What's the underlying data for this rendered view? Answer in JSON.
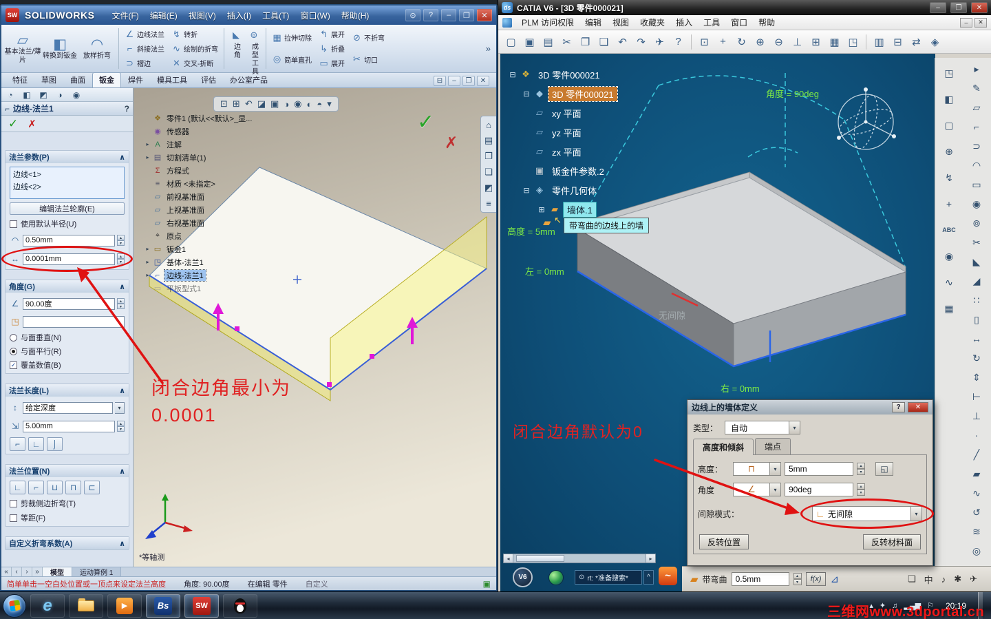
{
  "ui": {
    "chevron_up": "∧",
    "dropdown_arrow": "▾",
    "spin_up": "▴",
    "spin_down": "▾",
    "check": "✓",
    "cross": "✗",
    "help": "?",
    "minimize": "–",
    "restore": "❐",
    "close": "✕",
    "overflow": "»",
    "search": "⊙",
    "caret_up": "^"
  },
  "watermark": "三维网www.3dportal.cn",
  "solidworks": {
    "logo_badge": "SW",
    "logo_text": "SOLIDWORKS",
    "menus": [
      "文件(F)",
      "编辑(E)",
      "视图(V)",
      "插入(I)",
      "工具(T)",
      "窗口(W)",
      "帮助(H)"
    ],
    "tabs": [
      {
        "label": "特征",
        "active": "false"
      },
      {
        "label": "草图",
        "active": "false"
      },
      {
        "label": "曲面",
        "active": "false"
      },
      {
        "label": "钣金",
        "active": "true"
      },
      {
        "label": "焊件",
        "active": "false"
      },
      {
        "label": "模具工具",
        "active": "false"
      },
      {
        "label": "评估",
        "active": "false"
      },
      {
        "label": "办公室产品",
        "active": "false"
      }
    ],
    "doc_controls": [
      {
        "name": "cascade-icon",
        "glyph": "⊟"
      },
      {
        "name": "doc-minimize-icon",
        "glyph": "–"
      },
      {
        "name": "doc-restore-icon",
        "glyph": "❐"
      },
      {
        "name": "doc-close-icon",
        "glyph": "✕"
      }
    ],
    "ribbon": {
      "big": [
        {
          "name": "base-flange-button",
          "glyph": "▱",
          "label": "基本法兰/薄片"
        },
        {
          "name": "convert-to-sheetmetal-button",
          "glyph": "◧",
          "label": "转换到钣金"
        },
        {
          "name": "lofted-bend-button",
          "glyph": "◠",
          "label": "放样折弯"
        }
      ],
      "stack1": [
        {
          "name": "edge-flange-button",
          "glyph": "∠",
          "label": "边线法兰"
        },
        {
          "name": "miter-flange-button",
          "glyph": "⌐",
          "label": "斜接法兰"
        },
        {
          "name": "hem-button",
          "glyph": "⊃",
          "label": "褶边"
        }
      ],
      "stack2": [
        {
          "name": "jog-button",
          "glyph": "↯",
          "label": "转折"
        },
        {
          "name": "sketched-bend-button",
          "glyph": "∿",
          "label": "绘制的折弯"
        },
        {
          "name": "cross-break-button",
          "glyph": "✕",
          "label": "交叉-折断"
        }
      ],
      "vertical": [
        {
          "name": "corners-button",
          "glyph": "◣",
          "label": "边角"
        },
        {
          "name": "forming-tool-button",
          "glyph": "⊚",
          "label": "成型工具"
        }
      ],
      "stack3": [
        {
          "name": "extruded-cut-button",
          "glyph": "▦",
          "label": "拉伸切除"
        },
        {
          "name": "simple-hole-button",
          "glyph": "◎",
          "label": "简单直孔"
        }
      ],
      "stack4": [
        {
          "name": "unfold-button",
          "glyph": "↰",
          "label": "展开"
        },
        {
          "name": "fold-button",
          "glyph": "↳",
          "label": "折叠"
        },
        {
          "name": "flatten-button",
          "glyph": "▭",
          "label": "展开"
        }
      ],
      "stack5": [
        {
          "name": "no-bends-button",
          "glyph": "⊘",
          "label": "不折弯"
        },
        {
          "name": "rip-button",
          "glyph": "✂",
          "label": "切口"
        }
      ]
    },
    "pm_tabs": [
      {
        "name": "featuremanager-tab-icon",
        "glyph": "◔"
      },
      {
        "name": "propertymanager-tab-icon",
        "glyph": "◧"
      },
      {
        "name": "configuration-tab-icon",
        "glyph": "◩"
      },
      {
        "name": "dimxpert-tab-icon",
        "glyph": "◑"
      },
      {
        "name": "appearance-tab-icon",
        "glyph": "◉"
      }
    ],
    "panel": {
      "title": "边线-法兰1",
      "title_icon": "⌐",
      "sections": {
        "params_title": "法兰参数(P)",
        "edges": [
          "边线<1>",
          "边线<2>"
        ],
        "edit_profile": "编辑法兰轮廓(E)",
        "use_default_radius": "使用默认半径(U)",
        "radius": "0.50mm",
        "gap": "0.0001mm",
        "angle_title": "角度(G)",
        "angle": "90.00度",
        "face": "",
        "normal_to_face": "与面垂直(N)",
        "parallel_to_face": "与面平行(R)",
        "override_value": "覆盖数值(B)",
        "length_title": "法兰长度(L)",
        "end_condition": "给定深度",
        "depth": "5.00mm",
        "position_title": "法兰位置(N)",
        "trim_side_bends": "剪裁侧边折弯(T)",
        "offset": "等距(F)",
        "custom_title": "自定义折弯系数(A)"
      },
      "length_buttons": [
        {
          "name": "outer-virtual-sharp-button",
          "glyph": "⌐"
        },
        {
          "name": "inner-virtual-sharp-button",
          "glyph": "∟"
        },
        {
          "name": "tangent-bend-button",
          "glyph": "⌡"
        }
      ],
      "position_buttons": [
        {
          "name": "material-inside-button",
          "glyph": "∟"
        },
        {
          "name": "material-outside-button",
          "glyph": "⌐"
        },
        {
          "name": "bend-outside-button",
          "glyph": "⊔"
        },
        {
          "name": "bend-from-virtual-sharp-button",
          "glyph": "⊓"
        },
        {
          "name": "tangent-to-bend-button",
          "glyph": "⊏"
        }
      ]
    },
    "tree": [
      {
        "glyph": "❖",
        "color": "#8a6d1e",
        "label": "零件1 (默认<<默认>_显...",
        "exp": "",
        "state": ""
      },
      {
        "glyph": "◉",
        "color": "#7a4fa0",
        "label": "传感器",
        "exp": "",
        "state": ""
      },
      {
        "glyph": "A",
        "color": "#2e7d4f",
        "label": "注解",
        "exp": "▸",
        "state": ""
      },
      {
        "glyph": "▤",
        "color": "#555577",
        "label": "切割清单(1)",
        "exp": "▸",
        "state": ""
      },
      {
        "glyph": "Σ",
        "color": "#a03030",
        "label": "方程式",
        "exp": "",
        "state": ""
      },
      {
        "glyph": "≡",
        "color": "#556",
        "label": "材质 <未指定>",
        "exp": "",
        "state": ""
      },
      {
        "glyph": "▱",
        "color": "#3a6a9a",
        "label": "前视基准面",
        "exp": "",
        "state": ""
      },
      {
        "glyph": "▱",
        "color": "#3a6a9a",
        "label": "上视基准面",
        "exp": "",
        "state": ""
      },
      {
        "glyph": "▱",
        "color": "#3a6a9a",
        "label": "右视基准面",
        "exp": "",
        "state": ""
      },
      {
        "glyph": "⌖",
        "color": "#333333",
        "label": "原点",
        "exp": "",
        "state": ""
      },
      {
        "glyph": "▭",
        "color": "#8a6d1e",
        "label": "钣金1",
        "exp": "▸",
        "state": ""
      },
      {
        "glyph": "◳",
        "color": "#33539e",
        "label": "基体-法兰1",
        "exp": "▸",
        "state": ""
      },
      {
        "glyph": "⌐",
        "color": "#33539e",
        "label": "边线-法兰1",
        "exp": "▸",
        "state": "sel"
      },
      {
        "glyph": "▭",
        "color": "#888899",
        "label": "平板型式1",
        "exp": "",
        "state": "dim"
      }
    ],
    "headsup": [
      {
        "name": "zoom-fit-icon",
        "glyph": "⊡"
      },
      {
        "name": "zoom-area-icon",
        "glyph": "⊞"
      },
      {
        "name": "previous-view-icon",
        "glyph": "↶"
      },
      {
        "name": "section-view-icon",
        "glyph": "◪"
      },
      {
        "name": "view-orientation-icon",
        "glyph": "▣"
      },
      {
        "name": "display-style-icon",
        "glyph": "◑"
      },
      {
        "name": "hide-show-icon",
        "glyph": "◉"
      },
      {
        "name": "edit-appearance-icon",
        "glyph": "◐"
      },
      {
        "name": "apply-scene-icon",
        "glyph": "◓"
      },
      {
        "name": "view-settings-icon",
        "glyph": "▾"
      }
    ],
    "taskpane": [
      {
        "name": "home-icon",
        "glyph": "⌂"
      },
      {
        "name": "design-library-icon",
        "glyph": "▤"
      },
      {
        "name": "file-explorer-icon",
        "glyph": "❐"
      },
      {
        "name": "view-palette-icon",
        "glyph": "❏"
      },
      {
        "name": "appearances-icon",
        "glyph": "◩"
      },
      {
        "name": "custom-properties-icon",
        "glyph": "≡"
      }
    ],
    "viewport": {
      "annotation_line1": "闭合边角最小为",
      "annotation_line2": "0.0001",
      "view_label": "*等轴测"
    },
    "doc_tabs_nav": [
      {
        "name": "first-tab-icon",
        "glyph": "«"
      },
      {
        "name": "prev-tab-icon",
        "glyph": "‹"
      },
      {
        "name": "next-tab-icon",
        "glyph": "›"
      },
      {
        "name": "last-tab-icon",
        "glyph": "»"
      }
    ],
    "doc_tabs": [
      {
        "label": "模型",
        "active": "true"
      },
      {
        "label": "运动算例 1",
        "active": "false"
      }
    ],
    "status": {
      "prompt": "简单单击一空白处位置或一顶点来设定法兰高度",
      "angle": "角度: 90.00度",
      "editing": "在编辑 零件",
      "custom": "自定义"
    }
  },
  "catia": {
    "title": "CATIA V6 - [3D 零件000021]",
    "app_icon": "ds",
    "menus": [
      "PLM 访问权限",
      "编辑",
      "视图",
      "收藏夹",
      "插入",
      "工具",
      "窗口",
      "帮助"
    ],
    "toolbar": [
      {
        "name": "new-file-icon",
        "glyph": "▢"
      },
      {
        "name": "open-file-icon",
        "glyph": "▣"
      },
      {
        "name": "print-icon",
        "glyph": "▤"
      },
      {
        "name": "cut-icon",
        "glyph": "✂"
      },
      {
        "name": "copy-icon",
        "glyph": "❐"
      },
      {
        "name": "paste-icon",
        "glyph": "❏"
      },
      {
        "name": "undo-icon",
        "glyph": "↶"
      },
      {
        "name": "redo-icon",
        "glyph": "↷"
      },
      {
        "name": "fly-mode-icon",
        "glyph": "✈"
      },
      {
        "name": "whats-this-icon",
        "glyph": "?"
      },
      {
        "name": "separator",
        "glyph": ""
      },
      {
        "name": "fit-all-icon",
        "glyph": "⊡"
      },
      {
        "name": "pan-icon",
        "glyph": "+"
      },
      {
        "name": "rotate-view-icon",
        "glyph": "↻"
      },
      {
        "name": "zoom-in-icon",
        "glyph": "⊕"
      },
      {
        "name": "zoom-out-icon",
        "glyph": "⊖"
      },
      {
        "name": "normal-view-icon",
        "glyph": "⊥"
      },
      {
        "name": "multi-view-icon",
        "glyph": "⊞"
      },
      {
        "name": "grid-icon",
        "glyph": "▦"
      },
      {
        "name": "isometric-icon",
        "glyph": "◳"
      },
      {
        "name": "separator",
        "glyph": ""
      },
      {
        "name": "catalog-icon",
        "glyph": "▥"
      },
      {
        "name": "sheet-icon",
        "glyph": "⊟"
      },
      {
        "name": "transfer-icon",
        "glyph": "⇄"
      },
      {
        "name": "assistant-icon",
        "glyph": "◈"
      }
    ],
    "right_toolbar": [
      {
        "name": "select-icon",
        "glyph": "▸"
      },
      {
        "name": "sketcher-icon",
        "glyph": "✎"
      },
      {
        "name": "wall-icon",
        "glyph": "▱"
      },
      {
        "name": "flange-icon",
        "glyph": "⌐"
      },
      {
        "name": "hem-icon",
        "glyph": "⊃"
      },
      {
        "name": "bend-icon",
        "glyph": "◠"
      },
      {
        "name": "unfold-icon",
        "glyph": "▭"
      },
      {
        "name": "stamp-icon",
        "glyph": "◉"
      },
      {
        "name": "hole-icon",
        "glyph": "⊚"
      },
      {
        "name": "cutout-icon",
        "glyph": "✂"
      },
      {
        "name": "corner-relief-icon",
        "glyph": "◣"
      },
      {
        "name": "chamfer-icon",
        "glyph": "◢"
      },
      {
        "name": "pattern-icon",
        "glyph": "∷"
      },
      {
        "name": "mirror-icon",
        "glyph": "▯"
      },
      {
        "name": "translate-icon",
        "glyph": "↔"
      },
      {
        "name": "rotate-tool-icon",
        "glyph": "↻"
      },
      {
        "name": "scale-icon",
        "glyph": "⇕"
      },
      {
        "name": "measure-icon",
        "glyph": "⊢"
      },
      {
        "name": "constraint-icon",
        "glyph": "⊥"
      },
      {
        "name": "point-icon",
        "glyph": "∙"
      },
      {
        "name": "line-icon",
        "glyph": "╱"
      },
      {
        "name": "plane-icon",
        "glyph": "▰"
      },
      {
        "name": "spline-icon",
        "glyph": "∿"
      },
      {
        "name": "update-icon",
        "glyph": "↺"
      },
      {
        "name": "analysis-icon",
        "glyph": "≋"
      },
      {
        "name": "camera-icon",
        "glyph": "◎"
      }
    ],
    "inner_toolbar": [
      {
        "name": "box-icon",
        "glyph": "◳"
      },
      {
        "name": "shading-icon",
        "glyph": "◧"
      },
      {
        "name": "wireframe-icon",
        "glyph": "▢"
      },
      {
        "name": "compass-tool-icon",
        "glyph": "⊕"
      },
      {
        "name": "lightning-icon",
        "glyph": "↯"
      },
      {
        "name": "move-icon",
        "glyph": "+"
      },
      {
        "name": "abc-icon",
        "glyph": "ABC"
      },
      {
        "name": "target-icon",
        "glyph": "◉"
      },
      {
        "name": "curve-icon",
        "glyph": "∿"
      },
      {
        "name": "grid-tool-icon",
        "glyph": "▦"
      }
    ],
    "tree": [
      {
        "glyph": "❖",
        "color": "#d8b23a",
        "label": "3D 零件000021",
        "indent": "0",
        "state": "",
        "exp": "⊟"
      },
      {
        "glyph": "◆",
        "color": "#9ac4e0",
        "label": "3D 零件000021",
        "indent": "1",
        "state": "sel",
        "exp": "⊟"
      },
      {
        "glyph": "▱",
        "color": "#8fb8d8",
        "label": "xy 平面",
        "indent": "1",
        "state": "",
        "exp": ""
      },
      {
        "glyph": "▱",
        "color": "#8fb8d8",
        "label": "yz 平面",
        "indent": "1",
        "state": "",
        "exp": ""
      },
      {
        "glyph": "▱",
        "color": "#8fb8d8",
        "label": "zx 平面",
        "indent": "1",
        "state": "",
        "exp": ""
      },
      {
        "glyph": "▣",
        "color": "#b8c4cc",
        "label": "钣金件参数.2",
        "indent": "1",
        "state": "",
        "exp": ""
      },
      {
        "glyph": "◈",
        "color": "#9ac4e0",
        "label": "零件几何体",
        "indent": "1",
        "state": "",
        "exp": "⊟"
      },
      {
        "glyph": "▰",
        "color": "#e8a33d",
        "label": "墙体.1",
        "indent": "2",
        "state": "hl",
        "exp": "⊞"
      }
    ],
    "tree_tooltip": "带弯曲的边线上的墙",
    "drag_icon": "▰",
    "drag_arrow": "↖",
    "labels": {
      "angle": "角度 = 90deg",
      "height": "高度 = 5mm",
      "left": "左 = 0mm",
      "right": "右 = 0mm",
      "gap": "无间隙"
    },
    "annotation": "闭合边角默认为0",
    "dialog": {
      "title": "边线上的墙体定义",
      "type_label": "类型：",
      "type_value": "自动",
      "tabs": [
        {
          "label": "高度和倾斜",
          "active": "true"
        },
        {
          "label": "端点",
          "active": "false"
        }
      ],
      "height_label": "高度：",
      "height_icon": "⊓",
      "height_value": "5mm",
      "angle_label": "角度",
      "angle_icon": "∠",
      "angle_value": "90deg",
      "gap_label": "间隙模式：",
      "gap_icon": "∟",
      "gap_value": "无间隙",
      "flip_position": "反转位置",
      "flip_material": "反转材料面",
      "corner_icon": "◱",
      "bend_icon": "▰",
      "bend_label": "带弯曲",
      "bend_value": "0.5mm",
      "fx": "f(x)",
      "apply_icon": "⊿"
    },
    "bottombar": {
      "v6": "V6",
      "search_text": "rt: *准备搜索*"
    },
    "dock_icons": [
      {
        "name": "document-bar-icon",
        "glyph": "❏"
      },
      {
        "name": "ime-chinese-icon",
        "glyph": "中"
      },
      {
        "name": "music-icon",
        "glyph": "♪"
      },
      {
        "name": "tools-icon",
        "glyph": "✱"
      },
      {
        "name": "send-icon",
        "glyph": "✈"
      }
    ]
  },
  "taskbar": {
    "clock": "20:19",
    "apps": {
      "ie": "e",
      "media": "▶",
      "catia": "Bs",
      "solidworks": "SW"
    },
    "tray": [
      {
        "name": "show-hidden-icons-icon",
        "glyph": "▴"
      },
      {
        "name": "usb-icon",
        "glyph": "✦"
      },
      {
        "name": "volume-icon",
        "glyph": "♫"
      },
      {
        "name": "network-icon",
        "glyph": "▂▄▆"
      },
      {
        "name": "action-center-icon",
        "glyph": "⚐"
      }
    ]
  }
}
